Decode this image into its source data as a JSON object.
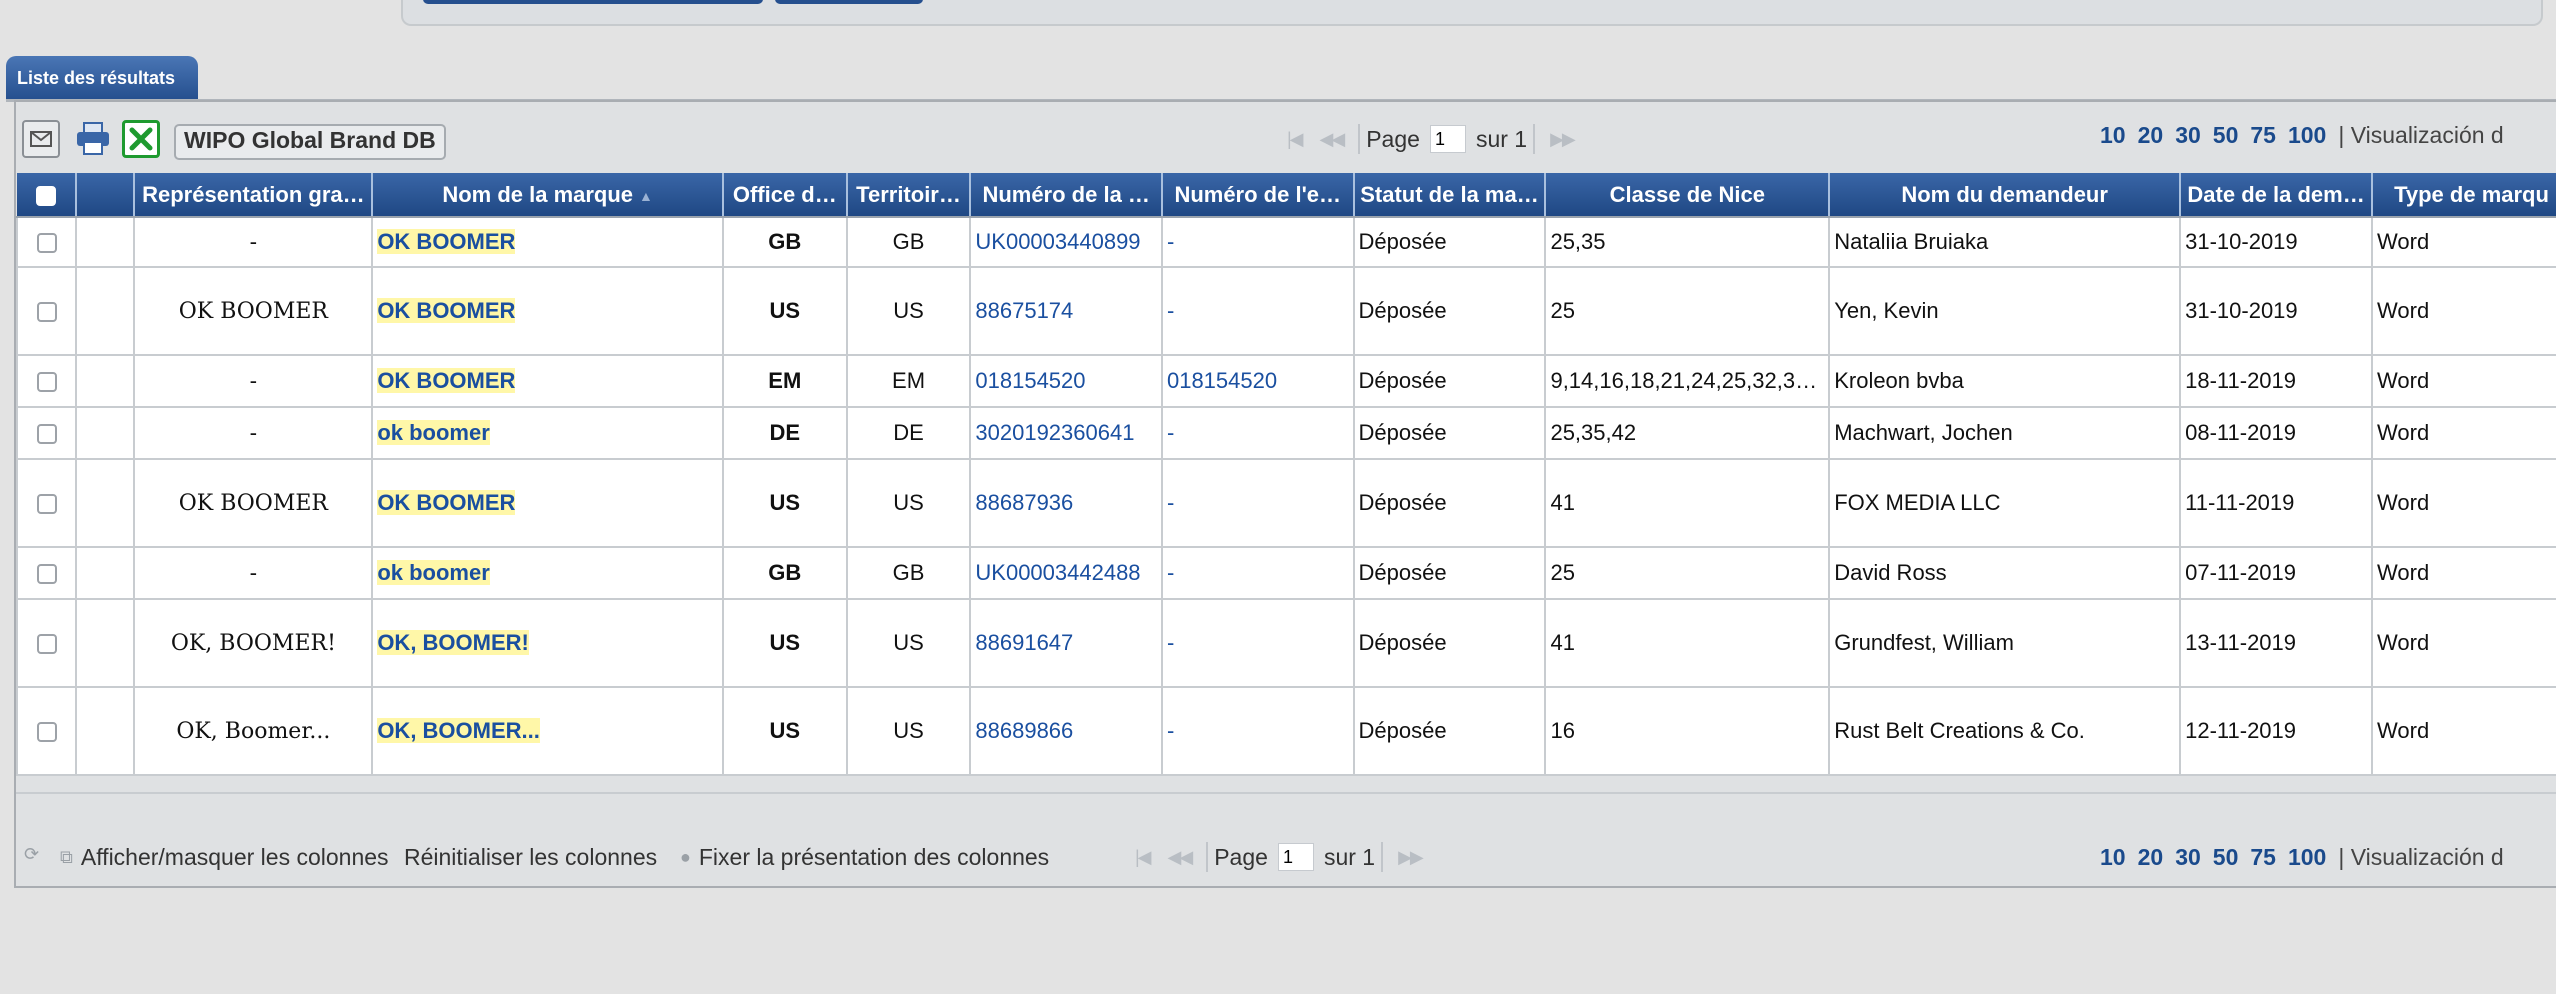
{
  "results_tab": {
    "label": "Liste des résultats"
  },
  "toolbar": {
    "email_icon": "email-icon",
    "print_icon": "print-icon",
    "excel_icon": "excel-export-icon",
    "wipo_label": "WIPO Global Brand DB",
    "page_label": "Page",
    "page_value": "1",
    "of_label": "sur 1",
    "rows_per_page": [
      "10",
      "20",
      "30",
      "50",
      "75",
      "100"
    ],
    "visualization_label": "| Visualización d"
  },
  "columns": [
    "",
    "",
    "Représentation gra…",
    "Nom de la marque",
    "Office d…",
    "Territoir…",
    "Numéro de la …",
    "Numéro de l'e…",
    "Statut de la ma…",
    "Classe de Nice",
    "Nom du demandeur",
    "Date de la dem…",
    "Type de marqu"
  ],
  "rows": [
    {
      "image": "-",
      "name": "OK BOOMER",
      "office": "GB",
      "territory": "GB",
      "number": "UK00003440899",
      "reg_number": "-",
      "status": "Déposée",
      "nice": "25,35",
      "applicant": "Nataliia Bruiaka",
      "date": "31-10-2019",
      "type": "Word"
    },
    {
      "image": "OK BOOMER",
      "name": "OK BOOMER",
      "office": "US",
      "territory": "US",
      "number": "88675174",
      "reg_number": "-",
      "status": "Déposée",
      "nice": "25",
      "applicant": "Yen, Kevin",
      "date": "31-10-2019",
      "type": "Word"
    },
    {
      "image": "-",
      "name": "OK BOOMER",
      "office": "EM",
      "territory": "EM",
      "number": "018154520",
      "reg_number": "018154520",
      "status": "Déposée",
      "nice": "9,14,16,18,21,24,25,32,3…",
      "applicant": "Kroleon bvba",
      "date": "18-11-2019",
      "type": "Word"
    },
    {
      "image": "-",
      "name": "ok boomer",
      "office": "DE",
      "territory": "DE",
      "number": "3020192360641",
      "reg_number": "-",
      "status": "Déposée",
      "nice": "25,35,42",
      "applicant": "Machwart, Jochen",
      "date": "08-11-2019",
      "type": "Word"
    },
    {
      "image": "OK BOOMER",
      "name": "OK BOOMER",
      "office": "US",
      "territory": "US",
      "number": "88687936",
      "reg_number": "-",
      "status": "Déposée",
      "nice": "41",
      "applicant": "FOX MEDIA LLC",
      "date": "11-11-2019",
      "type": "Word"
    },
    {
      "image": "-",
      "name": "ok boomer",
      "office": "GB",
      "territory": "GB",
      "number": "UK00003442488",
      "reg_number": "-",
      "status": "Déposée",
      "nice": "25",
      "applicant": "David Ross",
      "date": "07-11-2019",
      "type": "Word"
    },
    {
      "image": "OK, BOOMER!",
      "name": "OK, BOOMER!",
      "office": "US",
      "territory": "US",
      "number": "88691647",
      "reg_number": "-",
      "status": "Déposée",
      "nice": "41",
      "applicant": "Grundfest, William",
      "date": "13-11-2019",
      "type": "Word"
    },
    {
      "image": "OK, Boomer...",
      "name": "OK, BOOMER...",
      "office": "US",
      "territory": "US",
      "number": "88689866",
      "reg_number": "-",
      "status": "Déposée",
      "nice": "16",
      "applicant": "Rust Belt Creations & Co.",
      "date": "12-11-2019",
      "type": "Word"
    }
  ],
  "footer": {
    "refresh_icon": "refresh-icon",
    "toggle_columns": "Afficher/masquer les colonnes",
    "reset_columns": "Réinitialiser les colonnes",
    "fix_columns": "Fixer la présentation des colonnes",
    "page_label": "Page",
    "page_value": "1",
    "of_label": "sur 1",
    "rows_per_page": [
      "10",
      "20",
      "30",
      "50",
      "75",
      "100"
    ],
    "visualization_label": "| Visualización d"
  }
}
